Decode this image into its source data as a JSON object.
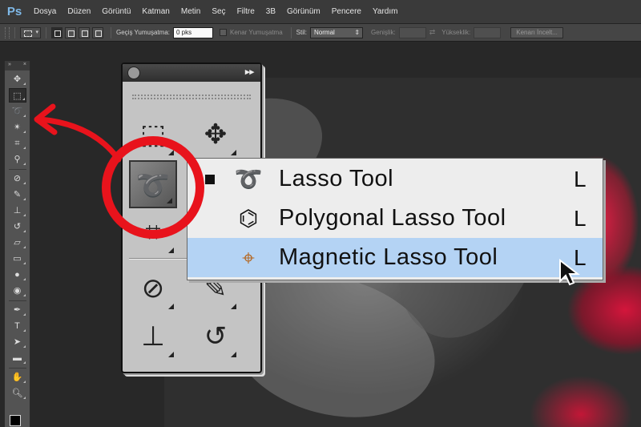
{
  "app": {
    "logo_text": "Ps",
    "menu": [
      "Dosya",
      "Düzen",
      "Görüntü",
      "Katman",
      "Metin",
      "Seç",
      "Filtre",
      "3B",
      "Görünüm",
      "Pencere",
      "Yardım"
    ]
  },
  "options_bar": {
    "feather_label": "Geçiş Yumuşatma:",
    "feather_value": "0 pks",
    "antialias_label": "Kenar Yumuşatma",
    "style_label": "Stil:",
    "style_value": "Normal",
    "width_label": "Genişlik:",
    "height_label": "Yükseklik:",
    "refine_button": "Kenarı İncelt..."
  },
  "toolbar": {
    "head_left": "»",
    "head_right": "×",
    "tools": [
      "move-icon",
      "marquee-icon",
      "lasso-icon",
      "magic-wand-icon",
      "crop-icon",
      "eyedropper-icon",
      "healing-brush-icon",
      "brush-icon",
      "clone-stamp-icon",
      "history-brush-icon",
      "eraser-icon",
      "gradient-icon",
      "blur-icon",
      "dodge-icon",
      "pen-icon",
      "type-icon",
      "path-selection-icon",
      "shape-icon",
      "hand-icon",
      "zoom-icon"
    ]
  },
  "zoom_panel": {
    "header_arrows": "▸▸"
  },
  "flyout": {
    "items": [
      {
        "label": "Lasso Tool",
        "shortcut": "L",
        "icon": "lasso-icon",
        "current": true
      },
      {
        "label": "Polygonal Lasso Tool",
        "shortcut": "L",
        "icon": "polygonal-lasso-icon",
        "current": false
      },
      {
        "label": "Magnetic Lasso Tool",
        "shortcut": "L",
        "icon": "magnetic-lasso-icon",
        "current": false
      }
    ]
  },
  "colors": {
    "highlight": "#b4d3f4",
    "annotation_red": "#e8131c",
    "flower_red": "#dc143c"
  }
}
